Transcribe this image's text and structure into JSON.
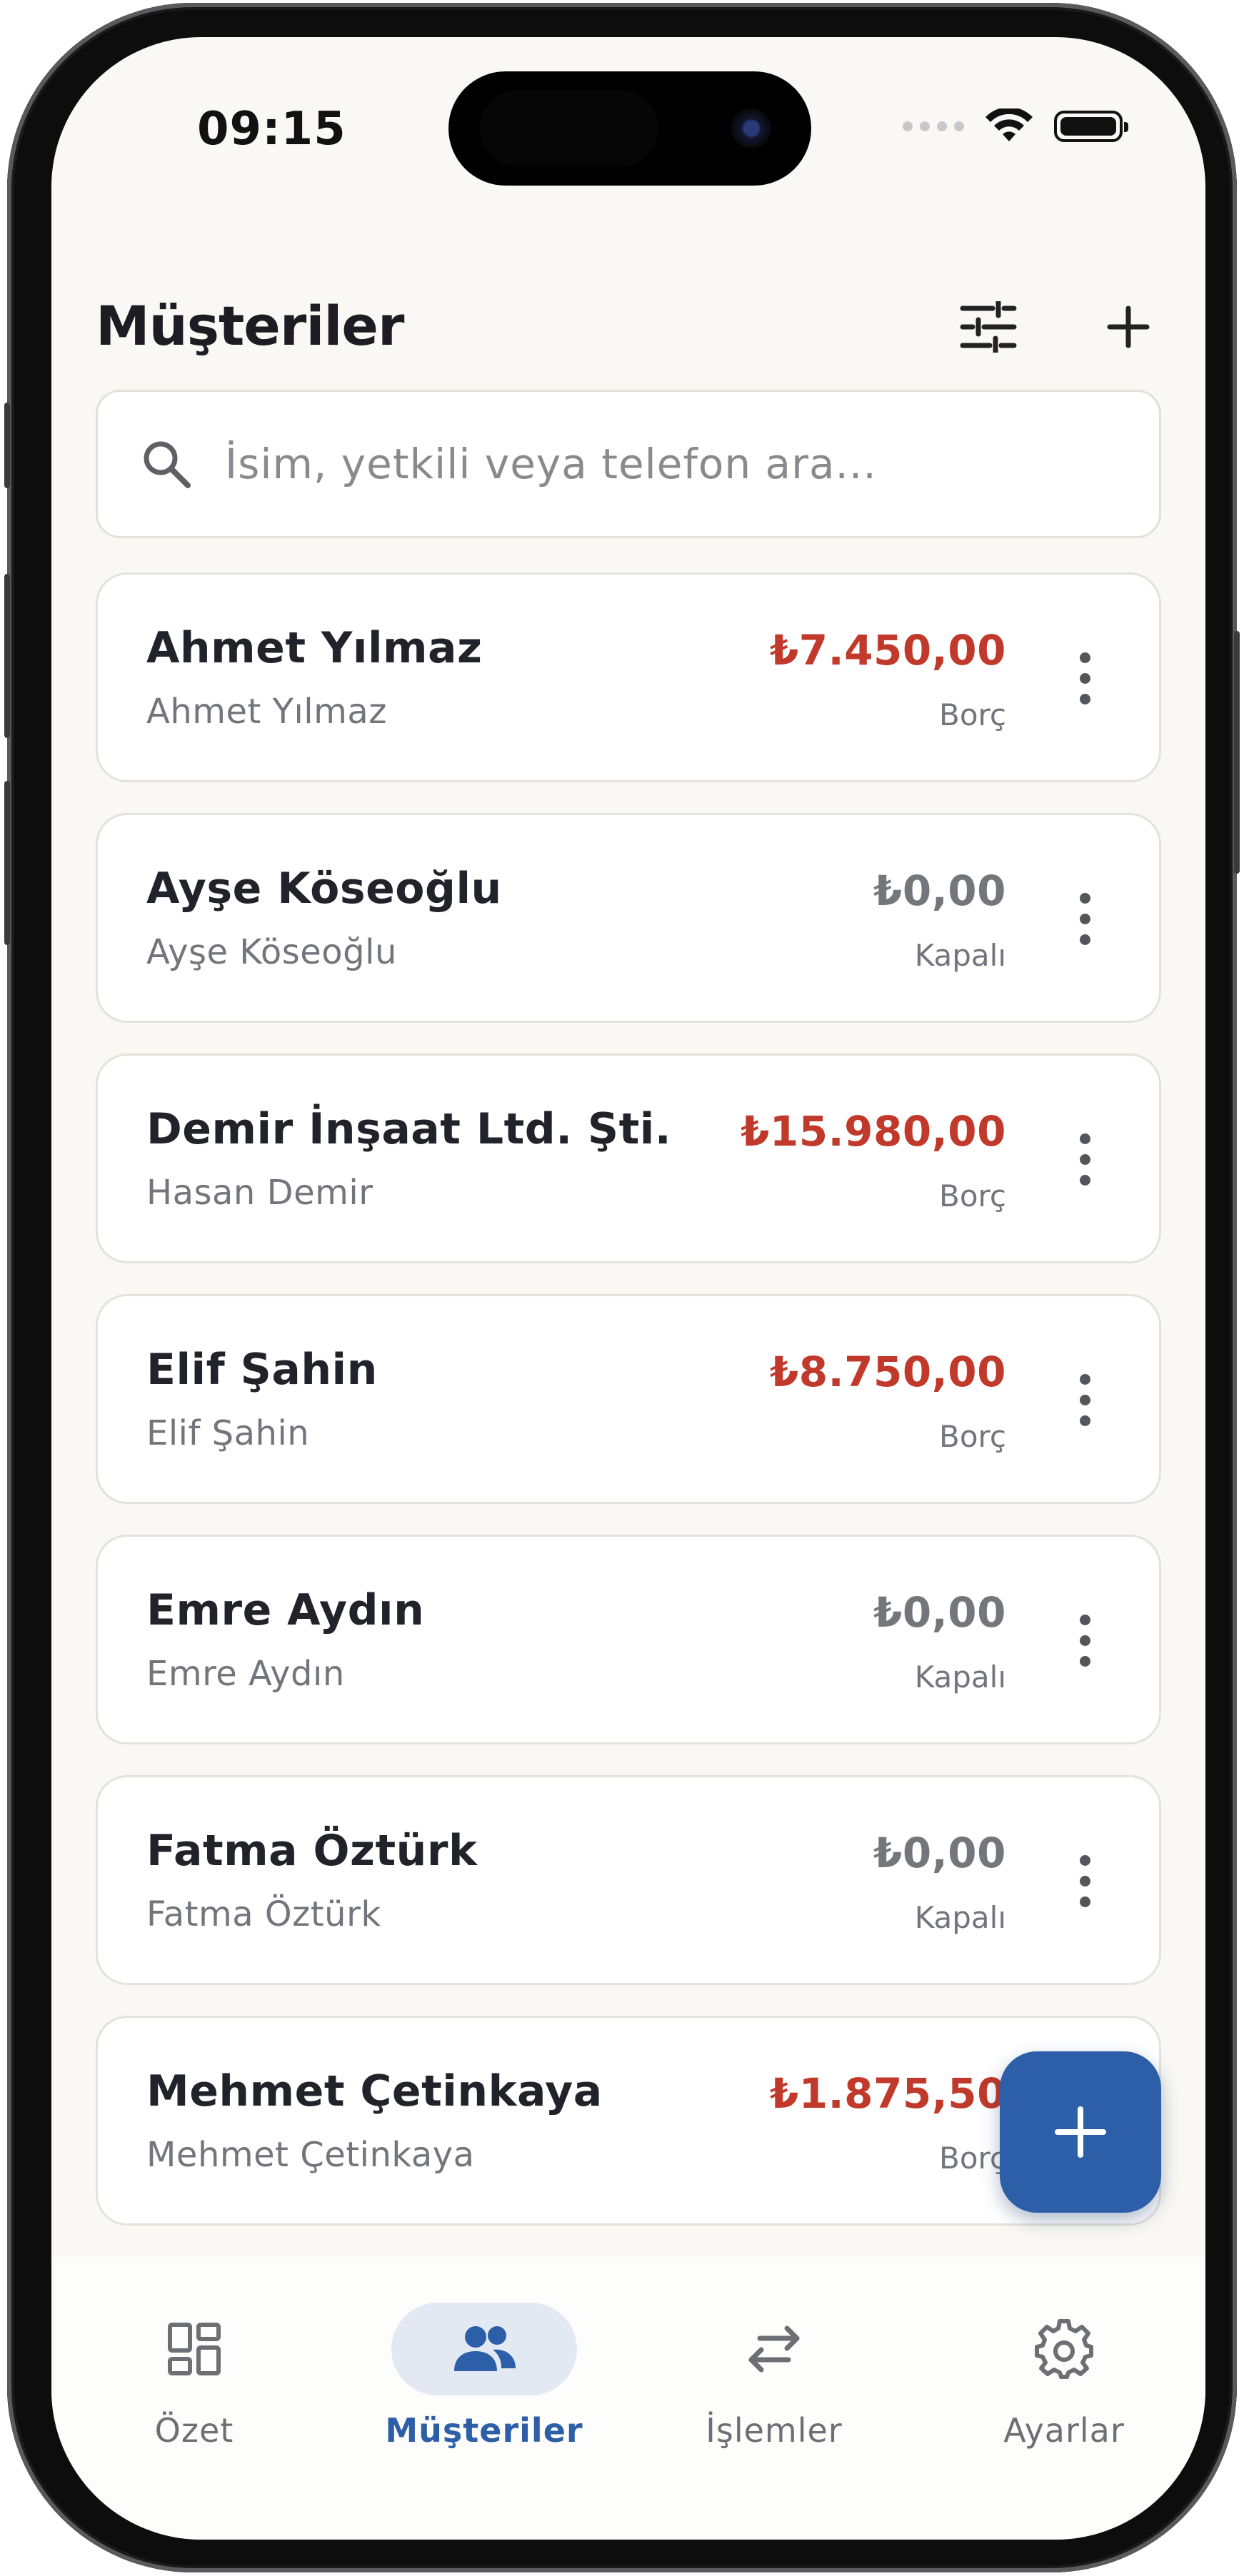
{
  "status_bar": {
    "time": "09:15"
  },
  "header": {
    "title": "Müşteriler"
  },
  "search": {
    "placeholder": "İsim, yetkili veya telefon ara..."
  },
  "customers": [
    {
      "name": "Ahmet Yılmaz",
      "contact": "Ahmet Yılmaz",
      "amount": "₺7.450,00",
      "status": "Borç"
    },
    {
      "name": "Ayşe Köseoğlu",
      "contact": "Ayşe Köseoğlu",
      "amount": "₺0,00",
      "status": "Kapalı"
    },
    {
      "name": "Demir İnşaat Ltd. Şti.",
      "contact": "Hasan Demir",
      "amount": "₺15.980,00",
      "status": "Borç"
    },
    {
      "name": "Elif Şahin",
      "contact": "Elif Şahin",
      "amount": "₺8.750,00",
      "status": "Borç"
    },
    {
      "name": "Emre Aydın",
      "contact": "Emre Aydın",
      "amount": "₺0,00",
      "status": "Kapalı"
    },
    {
      "name": "Fatma Öztürk",
      "contact": "Fatma Öztürk",
      "amount": "₺0,00",
      "status": "Kapalı"
    },
    {
      "name": "Mehmet Çetinkaya",
      "contact": "Mehmet Çetinkaya",
      "amount": "₺1.875,50",
      "status": "Borç"
    }
  ],
  "nav": {
    "items": [
      {
        "label": "Özet",
        "icon": "dashboard-icon"
      },
      {
        "label": "Müşteriler",
        "icon": "people-icon",
        "active": true
      },
      {
        "label": "İşlemler",
        "icon": "swap-icon"
      },
      {
        "label": "Ayarlar",
        "icon": "gear-icon"
      }
    ]
  },
  "colors": {
    "accent": "#2d5ea8",
    "debt": "#c0392b",
    "background": "#f9f8f4"
  }
}
